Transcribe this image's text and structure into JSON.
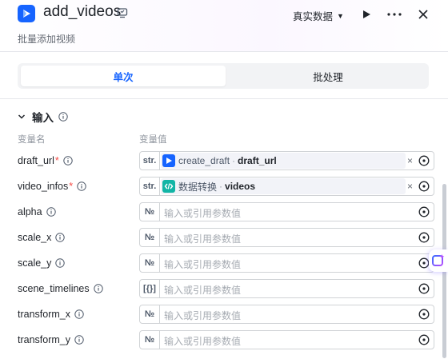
{
  "header": {
    "title": "add_videos",
    "subtitle": "批量添加视频",
    "data_mode": "真实数据",
    "icons": [
      "video-app-icon",
      "node-settings-icon",
      "caret-down-icon",
      "run-play-icon",
      "more-options-icon",
      "close-icon"
    ]
  },
  "tabs": [
    "单次",
    "批处理"
  ],
  "active_tab": "单次",
  "section": {
    "title": "输入"
  },
  "columns": {
    "name": "变量名",
    "value": "变量值"
  },
  "params": [
    {
      "name": "draft_url",
      "required": true,
      "type": "str.",
      "ref": {
        "source": "create_draft",
        "var": "draft_url"
      }
    },
    {
      "name": "video_infos",
      "required": true,
      "type": "str.",
      "ref": {
        "source": "数据转换",
        "var": "videos"
      }
    },
    {
      "name": "alpha",
      "required": false,
      "type": "№",
      "placeholder": "输入或引用参数值"
    },
    {
      "name": "scale_x",
      "required": false,
      "type": "№",
      "placeholder": "输入或引用参数值"
    },
    {
      "name": "scale_y",
      "required": false,
      "type": "№",
      "placeholder": "输入或引用参数值"
    },
    {
      "name": "scene_timelines",
      "required": false,
      "type": "[{}]",
      "placeholder": "输入或引用参数值"
    },
    {
      "name": "transform_x",
      "required": false,
      "type": "№",
      "placeholder": "输入或引用参数值"
    },
    {
      "name": "transform_y",
      "required": false,
      "type": "№",
      "placeholder": "输入或引用参数值"
    }
  ],
  "colors": {
    "accent": "#1664ff",
    "required": "#f54a45",
    "convert_icon": "#12b5a6"
  }
}
